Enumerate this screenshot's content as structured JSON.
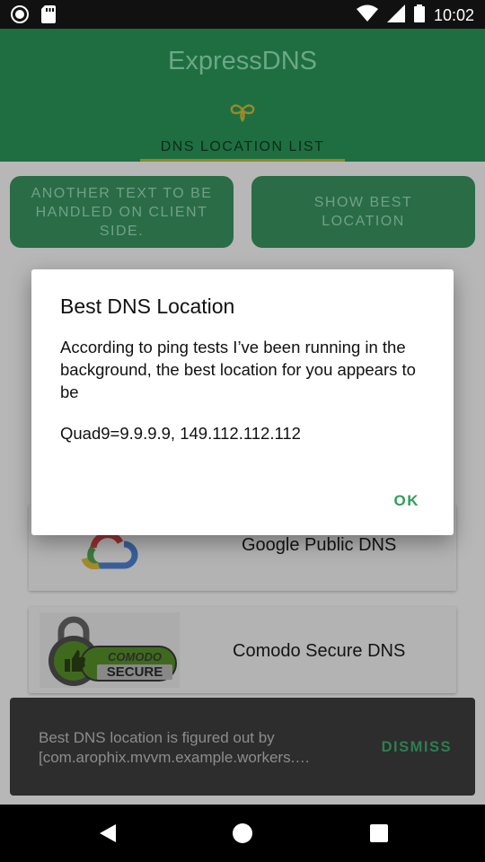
{
  "status_bar": {
    "time": "10:02",
    "icons": [
      "record-icon",
      "sd-card-icon",
      "wifi-icon",
      "signal-icon",
      "battery-icon"
    ]
  },
  "header": {
    "title": "ExpressDNS",
    "logo_icon": "knot-logo-icon",
    "tab_label": "DNS LOCATION LIST"
  },
  "actions": {
    "another_text": "ANOTHER TEXT TO BE HANDLED ON CLIENT SIDE.",
    "show_best": "SHOW BEST LOCATION"
  },
  "dns_list": [
    {
      "name": "Google Public DNS",
      "icon": "google-cloud-icon"
    },
    {
      "name": "Comodo Secure DNS",
      "icon": "comodo-secure-icon",
      "badge_top": "COMODO",
      "badge_bottom": "SECURE"
    }
  ],
  "dialog": {
    "title": "Best DNS Location",
    "body": "According to ping tests I’ve been running in the background, the best location for you appears to be",
    "result": "Quad9=9.9.9.9, 149.112.112.112",
    "ok_label": "OK"
  },
  "snackbar": {
    "line1": "Best DNS location is figured out by",
    "line2": "[com.arophix.mvvm.example.workers.…",
    "dismiss_label": "DISMISS"
  },
  "colors": {
    "header_green": "#1e6e42",
    "accent_green": "#2e9e5a",
    "snackbar_bg": "#2d2d2d"
  }
}
